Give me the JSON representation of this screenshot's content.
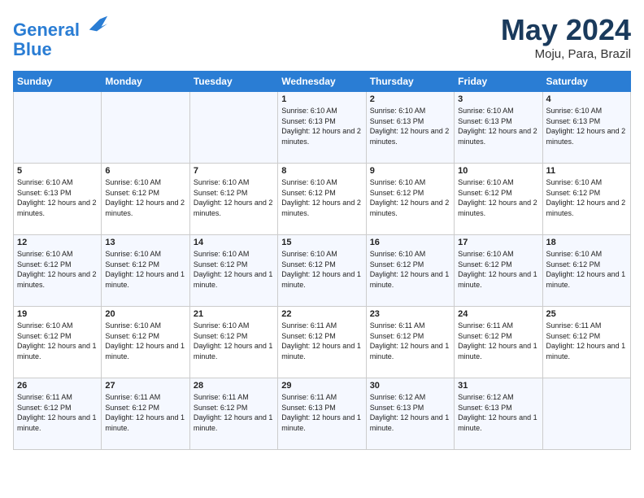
{
  "header": {
    "logo_line1": "General",
    "logo_line2": "Blue",
    "month_year": "May 2024",
    "location": "Moju, Para, Brazil"
  },
  "weekdays": [
    "Sunday",
    "Monday",
    "Tuesday",
    "Wednesday",
    "Thursday",
    "Friday",
    "Saturday"
  ],
  "weeks": [
    [
      {
        "day": "",
        "info": ""
      },
      {
        "day": "",
        "info": ""
      },
      {
        "day": "",
        "info": ""
      },
      {
        "day": "1",
        "info": "Sunrise: 6:10 AM\nSunset: 6:13 PM\nDaylight: 12 hours\nand 2 minutes."
      },
      {
        "day": "2",
        "info": "Sunrise: 6:10 AM\nSunset: 6:13 PM\nDaylight: 12 hours\nand 2 minutes."
      },
      {
        "day": "3",
        "info": "Sunrise: 6:10 AM\nSunset: 6:13 PM\nDaylight: 12 hours\nand 2 minutes."
      },
      {
        "day": "4",
        "info": "Sunrise: 6:10 AM\nSunset: 6:13 PM\nDaylight: 12 hours\nand 2 minutes."
      }
    ],
    [
      {
        "day": "5",
        "info": "Sunrise: 6:10 AM\nSunset: 6:13 PM\nDaylight: 12 hours\nand 2 minutes."
      },
      {
        "day": "6",
        "info": "Sunrise: 6:10 AM\nSunset: 6:12 PM\nDaylight: 12 hours\nand 2 minutes."
      },
      {
        "day": "7",
        "info": "Sunrise: 6:10 AM\nSunset: 6:12 PM\nDaylight: 12 hours\nand 2 minutes."
      },
      {
        "day": "8",
        "info": "Sunrise: 6:10 AM\nSunset: 6:12 PM\nDaylight: 12 hours\nand 2 minutes."
      },
      {
        "day": "9",
        "info": "Sunrise: 6:10 AM\nSunset: 6:12 PM\nDaylight: 12 hours\nand 2 minutes."
      },
      {
        "day": "10",
        "info": "Sunrise: 6:10 AM\nSunset: 6:12 PM\nDaylight: 12 hours\nand 2 minutes."
      },
      {
        "day": "11",
        "info": "Sunrise: 6:10 AM\nSunset: 6:12 PM\nDaylight: 12 hours\nand 2 minutes."
      }
    ],
    [
      {
        "day": "12",
        "info": "Sunrise: 6:10 AM\nSunset: 6:12 PM\nDaylight: 12 hours\nand 2 minutes."
      },
      {
        "day": "13",
        "info": "Sunrise: 6:10 AM\nSunset: 6:12 PM\nDaylight: 12 hours\nand 1 minute."
      },
      {
        "day": "14",
        "info": "Sunrise: 6:10 AM\nSunset: 6:12 PM\nDaylight: 12 hours\nand 1 minute."
      },
      {
        "day": "15",
        "info": "Sunrise: 6:10 AM\nSunset: 6:12 PM\nDaylight: 12 hours\nand 1 minute."
      },
      {
        "day": "16",
        "info": "Sunrise: 6:10 AM\nSunset: 6:12 PM\nDaylight: 12 hours\nand 1 minute."
      },
      {
        "day": "17",
        "info": "Sunrise: 6:10 AM\nSunset: 6:12 PM\nDaylight: 12 hours\nand 1 minute."
      },
      {
        "day": "18",
        "info": "Sunrise: 6:10 AM\nSunset: 6:12 PM\nDaylight: 12 hours\nand 1 minute."
      }
    ],
    [
      {
        "day": "19",
        "info": "Sunrise: 6:10 AM\nSunset: 6:12 PM\nDaylight: 12 hours\nand 1 minute."
      },
      {
        "day": "20",
        "info": "Sunrise: 6:10 AM\nSunset: 6:12 PM\nDaylight: 12 hours\nand 1 minute."
      },
      {
        "day": "21",
        "info": "Sunrise: 6:10 AM\nSunset: 6:12 PM\nDaylight: 12 hours\nand 1 minute."
      },
      {
        "day": "22",
        "info": "Sunrise: 6:11 AM\nSunset: 6:12 PM\nDaylight: 12 hours\nand 1 minute."
      },
      {
        "day": "23",
        "info": "Sunrise: 6:11 AM\nSunset: 6:12 PM\nDaylight: 12 hours\nand 1 minute."
      },
      {
        "day": "24",
        "info": "Sunrise: 6:11 AM\nSunset: 6:12 PM\nDaylight: 12 hours\nand 1 minute."
      },
      {
        "day": "25",
        "info": "Sunrise: 6:11 AM\nSunset: 6:12 PM\nDaylight: 12 hours\nand 1 minute."
      }
    ],
    [
      {
        "day": "26",
        "info": "Sunrise: 6:11 AM\nSunset: 6:12 PM\nDaylight: 12 hours\nand 1 minute."
      },
      {
        "day": "27",
        "info": "Sunrise: 6:11 AM\nSunset: 6:12 PM\nDaylight: 12 hours\nand 1 minute."
      },
      {
        "day": "28",
        "info": "Sunrise: 6:11 AM\nSunset: 6:12 PM\nDaylight: 12 hours\nand 1 minute."
      },
      {
        "day": "29",
        "info": "Sunrise: 6:11 AM\nSunset: 6:13 PM\nDaylight: 12 hours\nand 1 minute."
      },
      {
        "day": "30",
        "info": "Sunrise: 6:12 AM\nSunset: 6:13 PM\nDaylight: 12 hours\nand 1 minute."
      },
      {
        "day": "31",
        "info": "Sunrise: 6:12 AM\nSunset: 6:13 PM\nDaylight: 12 hours\nand 1 minute."
      },
      {
        "day": "",
        "info": ""
      }
    ]
  ]
}
